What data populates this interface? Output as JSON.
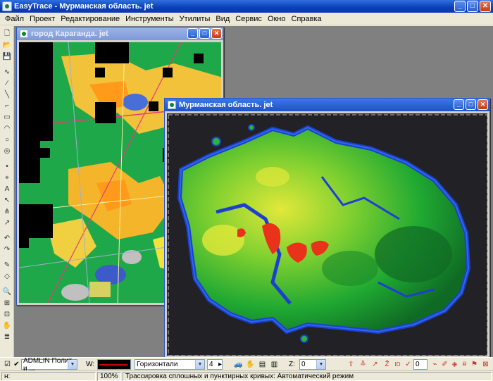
{
  "app": {
    "title": "EasyTrace - Мурманская область. jet"
  },
  "menu": [
    "Файл",
    "Проект",
    "Редактирование",
    "Инструменты",
    "Утилиты",
    "Вид",
    "Сервис",
    "Окно",
    "Справка"
  ],
  "windows": {
    "karaganda": {
      "title": "город Караганда. jet"
    },
    "murmansk": {
      "title": "Мурманская область. jet"
    }
  },
  "bottom_toolbar": {
    "layer_combo": "ADMLIN Полит. и ...",
    "w_label": "W:",
    "layer_type": "Горизонтали",
    "thickness": "4",
    "z_label": "Z:",
    "z_value": "0",
    "counter_value": "0"
  },
  "status": {
    "left": "н:",
    "zoom": "100%",
    "message": "Трассировка сплошных и пунктирных кривых: Автоматический режим"
  },
  "colors": {
    "titlebar": "#0a3fb8",
    "map_green": "#1ea84a",
    "map_yellow": "#f2e23a",
    "map_orange": "#ff9a1a",
    "terrain_green": "#2bb535",
    "terrain_blue": "#1d3fd0",
    "terrain_red": "#e8321a"
  }
}
